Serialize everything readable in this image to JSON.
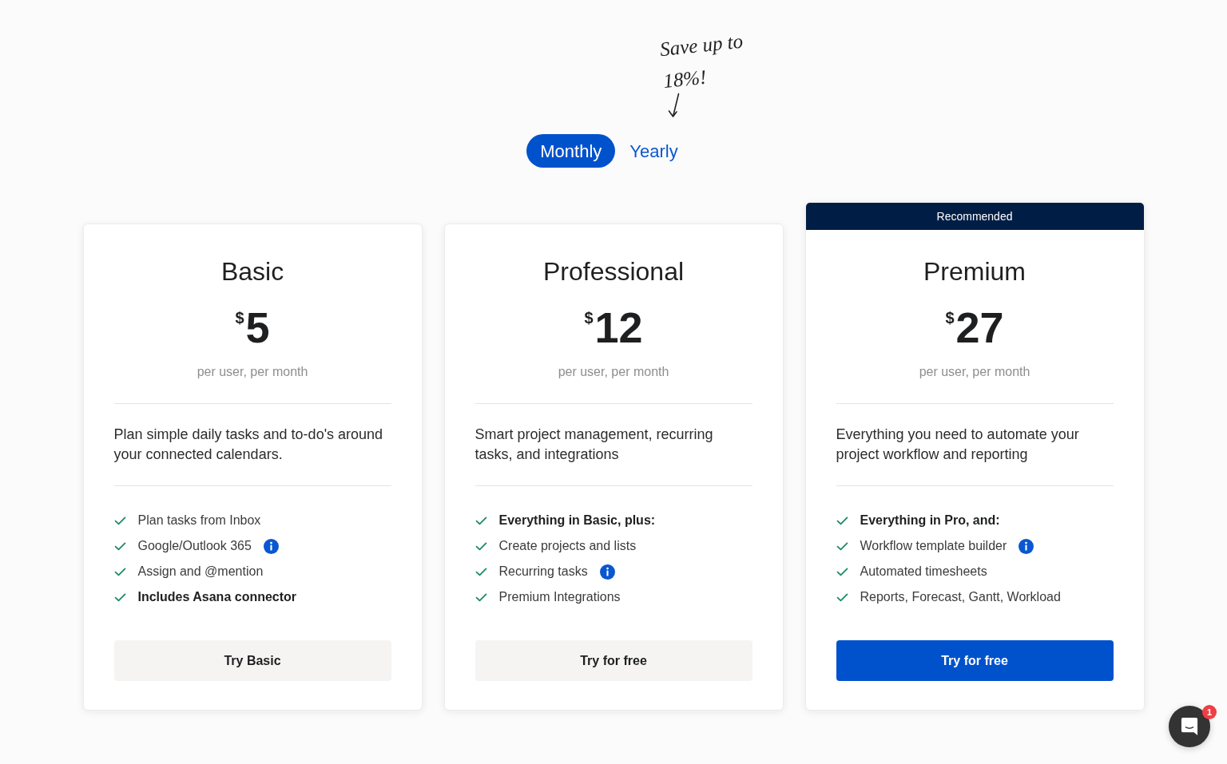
{
  "billing": {
    "note": "Save up to 18%!",
    "options": [
      {
        "label": "Monthly",
        "selected": true
      },
      {
        "label": "Yearly",
        "selected": false
      }
    ]
  },
  "plans": [
    {
      "name": "Basic",
      "currency": "$",
      "price": "5",
      "unit": "per user, per month",
      "description": "Plan simple daily tasks and to-do's around your connected calendars.",
      "features": [
        {
          "text": "Plan tasks from Inbox",
          "bold": false,
          "info": false
        },
        {
          "text": "Google/Outlook 365",
          "bold": false,
          "info": true
        },
        {
          "text": "Assign and @mention",
          "bold": false,
          "info": false
        },
        {
          "text": "Includes Asana connector",
          "bold": true,
          "info": false
        }
      ],
      "button": {
        "label": "Try Basic",
        "kind": "secondary"
      }
    },
    {
      "name": "Professional",
      "currency": "$",
      "price": "12",
      "unit": "per user, per month",
      "description": "Smart project management, recurring tasks, and integrations",
      "features": [
        {
          "text": "Everything in Basic, plus:",
          "bold": true,
          "info": false
        },
        {
          "text": "Create projects and lists",
          "bold": false,
          "info": false
        },
        {
          "text": "Recurring tasks",
          "bold": false,
          "info": true
        },
        {
          "text": "Premium Integrations",
          "bold": false,
          "info": false
        }
      ],
      "button": {
        "label": "Try for free",
        "kind": "secondary"
      }
    },
    {
      "badge": "Recommended",
      "name": "Premium",
      "currency": "$",
      "price": "27",
      "unit": "per user, per month",
      "description": "Everything you need to automate your project workflow and reporting",
      "features": [
        {
          "text": "Everything in Pro, and:",
          "bold": true,
          "info": false
        },
        {
          "text": "Workflow template builder",
          "bold": false,
          "info": true
        },
        {
          "text": "Automated timesheets",
          "bold": false,
          "info": false
        },
        {
          "text": "Reports, Forecast, Gantt, Workload",
          "bold": false,
          "info": false
        }
      ],
      "button": {
        "label": "Try for free",
        "kind": "primary"
      }
    }
  ],
  "chat": {
    "badge": "1"
  }
}
